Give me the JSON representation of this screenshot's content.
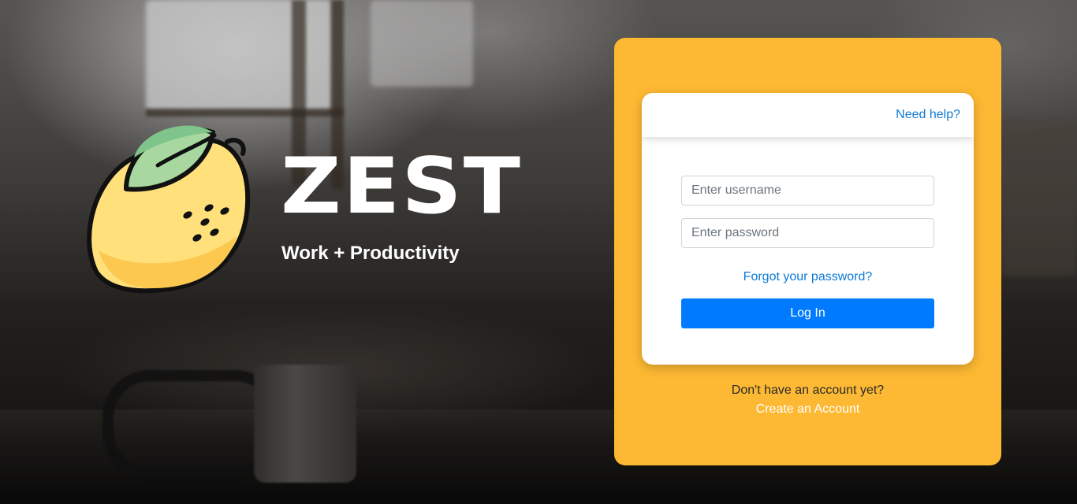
{
  "brand": {
    "name": "ZEST",
    "tagline": "Work + Productivity",
    "logo_icon": "lemon-icon"
  },
  "login": {
    "help_link": "Need help?",
    "username_placeholder": "Enter username",
    "password_placeholder": "Enter password",
    "forgot_link": "Forgot your password?",
    "submit_label": "Log In",
    "signup_prompt": "Don't have an account yet?",
    "signup_link": "Create an Account"
  },
  "colors": {
    "panel": "#fdb933",
    "primary_button": "#007bff",
    "link": "#0d79d6"
  }
}
